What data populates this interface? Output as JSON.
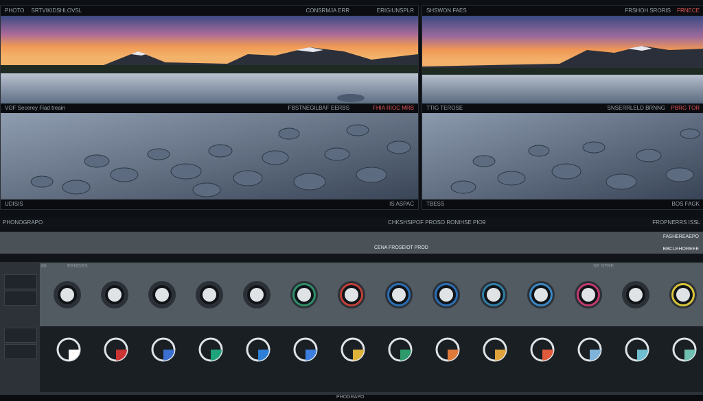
{
  "left_panel": {
    "top_bar": {
      "title": "PHOTO",
      "subtitle": "SRTVIKIDSHLOVSL",
      "right_a": "CONSRMJA ERR",
      "right_b": "ERIGIUNSPLR"
    },
    "mid_bar": {
      "title": "VOF Secerey Fiad treain",
      "right_a": "FBSTNEGILBAF EERBS",
      "right_b": "FHIA RIOC MRB"
    },
    "bottom_bar": {
      "left": "UDISIS",
      "right": "IS ASPAC"
    }
  },
  "right_panel": {
    "top_bar": {
      "title": "SHSWON FAES",
      "right_a": "FRSHOH SRORIS",
      "right_b": "FRNECE"
    },
    "mid_bar": {
      "title": "TTIG TEROSE",
      "right_a": "SNSERRLELD BRNNG",
      "right_b": "PBRG TOR"
    },
    "bottom_bar": {
      "left": "TBESS",
      "right": "BOS FAGK"
    }
  },
  "info_strip": {
    "left": "PHONOGRAPO",
    "center": "CHKSHSIPOF PROSO RONIHSE PIO9",
    "right": "FROPNERRS ISSL"
  },
  "controls": {
    "header_label": "CENA FROSEIOT PROD",
    "right_labels": [
      "FASHEREAEPO",
      "BBCLEHOREEE"
    ],
    "row_labels": [
      "88",
      "ERNGES",
      "SE STRE"
    ],
    "knob_count": 14,
    "footer_label": "PHOGRAPO"
  },
  "colors": {
    "accent": "#e25555",
    "panel_grey": "#4a5157",
    "dark": "#0d1014"
  },
  "icons": [
    "gauge-icon",
    "knob-icon"
  ]
}
